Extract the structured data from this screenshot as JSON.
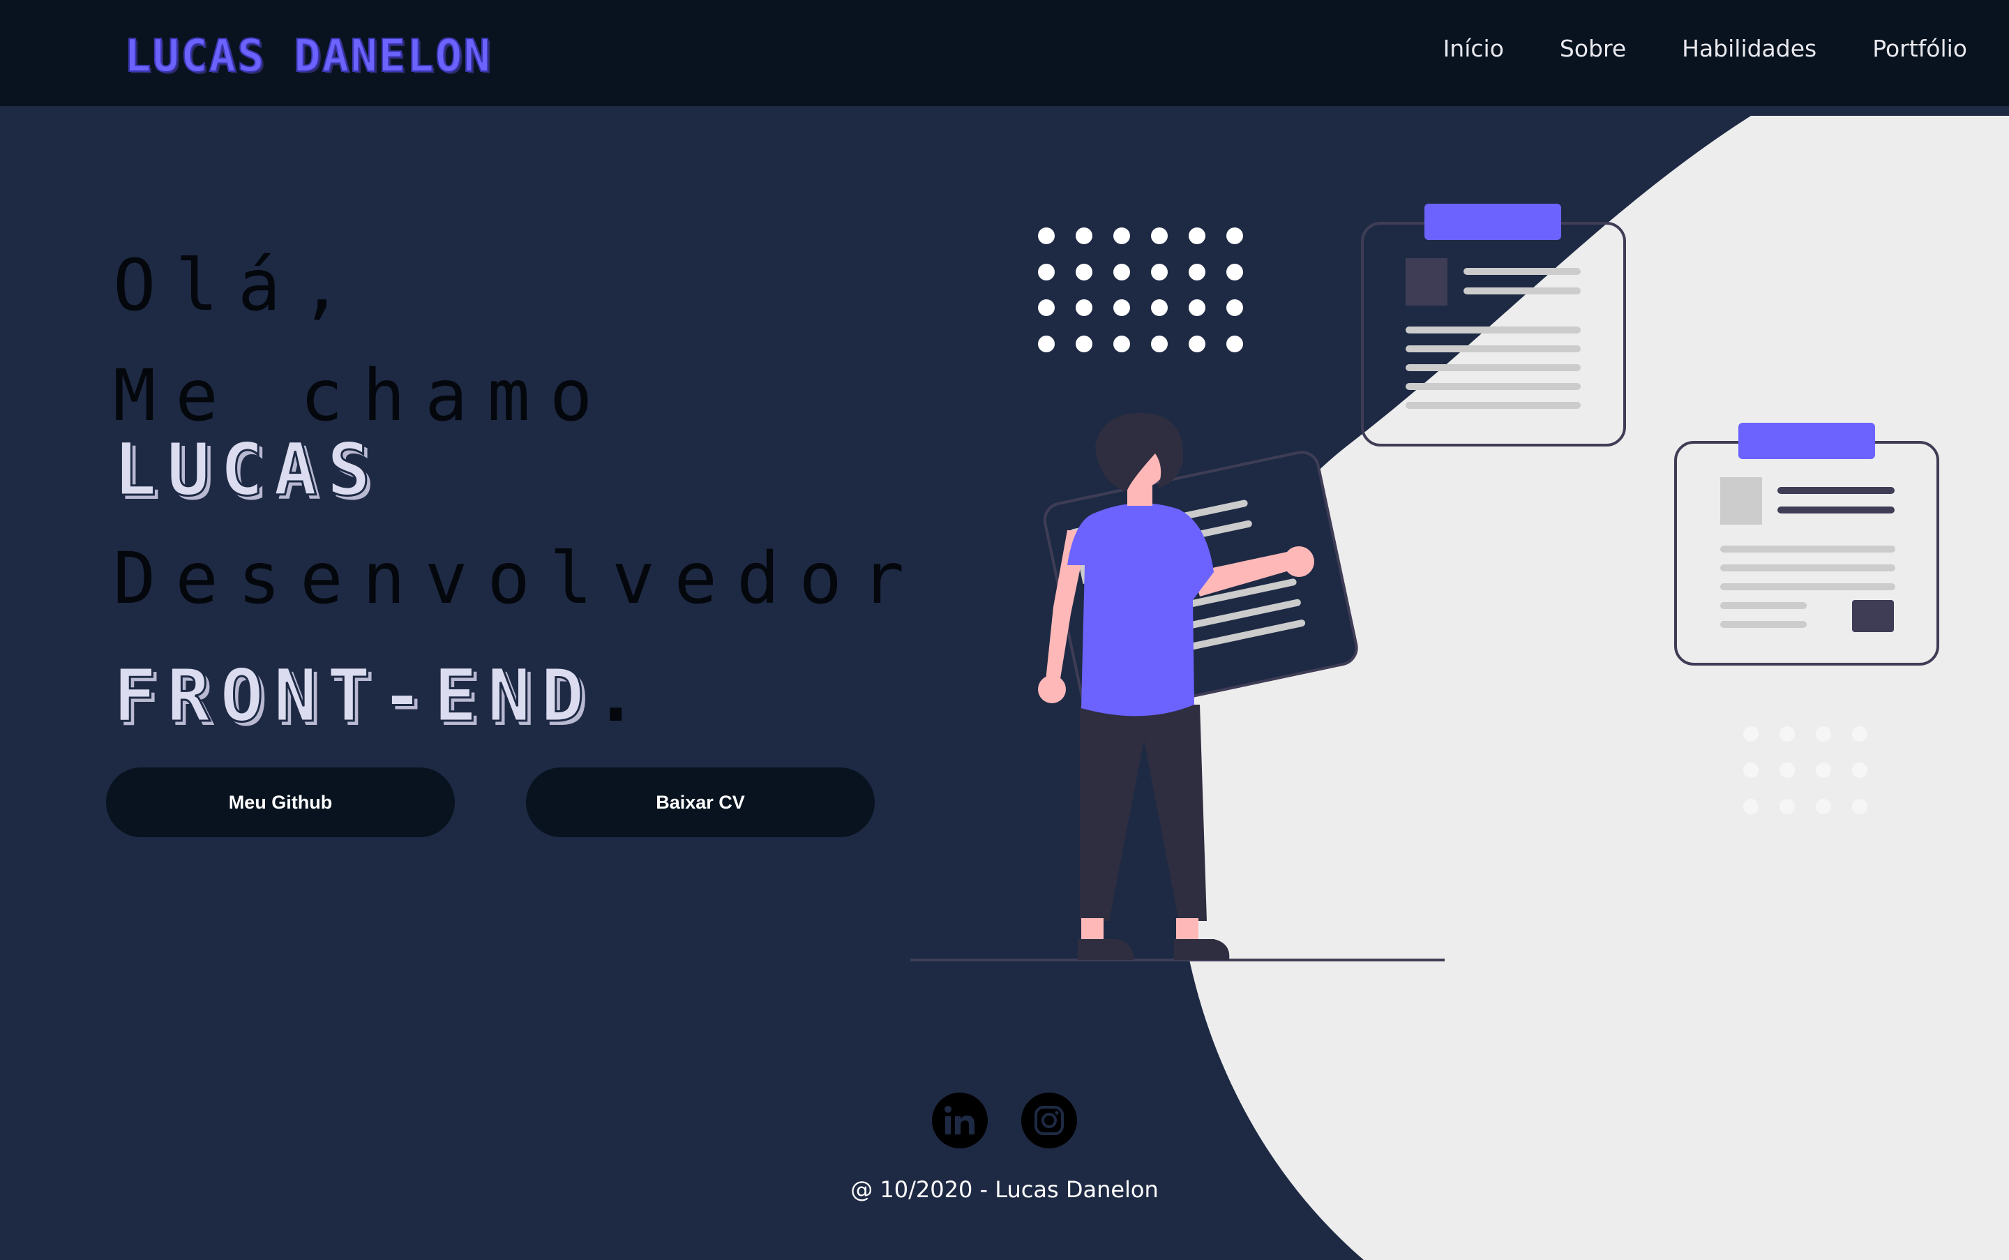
{
  "navbar": {
    "logo": "LUCAS DANELON",
    "links": [
      "Início",
      "Sobre",
      "Habilidades",
      "Portfólio"
    ]
  },
  "hero": {
    "greeting": "Olá,",
    "intro": "Me chamo",
    "name": "LUCAS",
    "role": "Desenvolvedor",
    "specialty": "FRONT-END",
    "specialty_suffix": "."
  },
  "buttons": {
    "github": "Meu Github",
    "cv": "Baixar CV"
  },
  "footer": {
    "social": [
      "linkedin-icon",
      "instagram-icon"
    ],
    "copyright": "@ 10/2020 - Lucas Danelon"
  },
  "colors": {
    "background": "#1e2a44",
    "navbar": "#08131f",
    "accent": "#6c63ff",
    "light_shape": "#ededed",
    "skin": "#ffb8b8",
    "dark_figure": "#2f2e41"
  }
}
